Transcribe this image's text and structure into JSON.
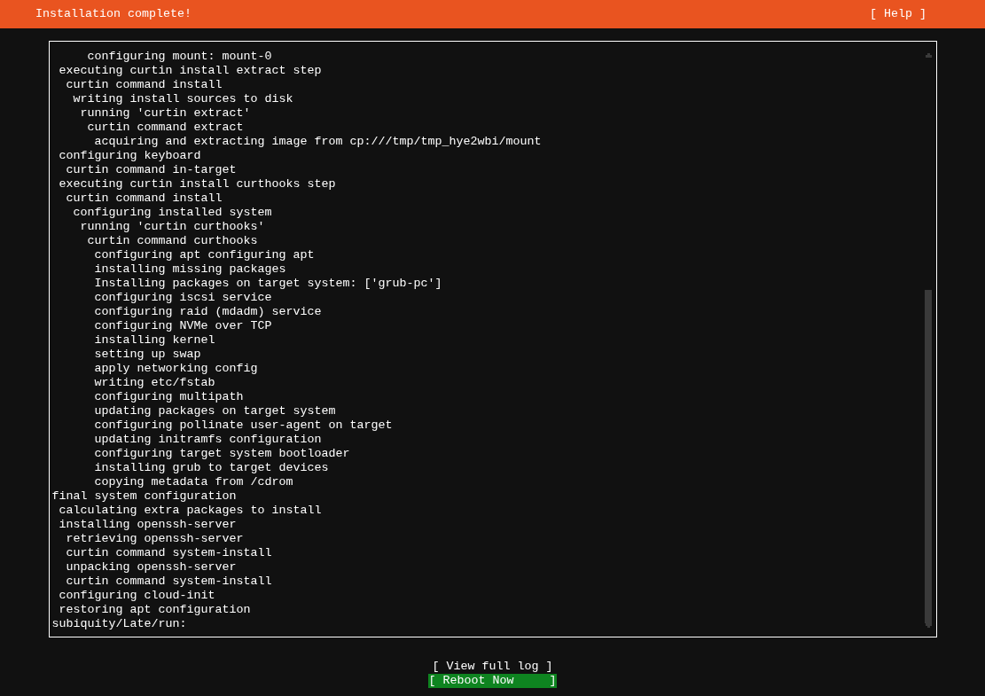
{
  "header": {
    "title": "Installation complete!",
    "help": "[ Help ]"
  },
  "log": [
    {
      "children": [
        {
          "children": [
            {
              "children": [
                {
                  "children": [
                    {
                      "children": [
                        {
                          "text": "configuring mount: mount-0"
                        }
                      ]
                    }
                  ]
                }
              ]
            }
          ]
        },
        {
          "text": "executing curtin install extract step",
          "children": [
            {
              "text": "curtin command install",
              "children": [
                {
                  "text": "writing install sources to disk",
                  "children": [
                    {
                      "text": "running 'curtin extract'",
                      "children": [
                        {
                          "text": "curtin command extract",
                          "children": [
                            {
                              "text": "acquiring and extracting image from cp:///tmp/tmp_hye2wbi/mount"
                            }
                          ]
                        }
                      ]
                    }
                  ]
                }
              ]
            }
          ]
        },
        {
          "text": "configuring keyboard",
          "children": [
            {
              "text": "curtin command in-target"
            }
          ]
        },
        {
          "text": "executing curtin install curthooks step",
          "children": [
            {
              "text": "curtin command install",
              "children": [
                {
                  "text": "configuring installed system",
                  "children": [
                    {
                      "text": "running 'curtin curthooks'",
                      "children": [
                        {
                          "text": "curtin command curthooks",
                          "children": [
                            {
                              "text": "configuring apt configuring apt"
                            },
                            {
                              "text": "installing missing packages"
                            },
                            {
                              "text": "Installing packages on target system: ['grub-pc']"
                            },
                            {
                              "text": "configuring iscsi service"
                            },
                            {
                              "text": "configuring raid (mdadm) service"
                            },
                            {
                              "text": "configuring NVMe over TCP"
                            },
                            {
                              "text": "installing kernel"
                            },
                            {
                              "text": "setting up swap"
                            },
                            {
                              "text": "apply networking config"
                            },
                            {
                              "text": "writing etc/fstab"
                            },
                            {
                              "text": "configuring multipath"
                            },
                            {
                              "text": "updating packages on target system"
                            },
                            {
                              "text": "configuring pollinate user-agent on target"
                            },
                            {
                              "text": "updating initramfs configuration"
                            },
                            {
                              "text": "configuring target system bootloader"
                            },
                            {
                              "text": "installing grub to target devices"
                            },
                            {
                              "text": "copying metadata from /cdrom"
                            }
                          ]
                        }
                      ]
                    }
                  ]
                }
              ]
            }
          ]
        }
      ]
    },
    {
      "text": "final system configuration",
      "children": [
        {
          "text": "calculating extra packages to install"
        },
        {
          "text": "installing openssh-server",
          "children": [
            {
              "text": "retrieving openssh-server"
            },
            {
              "text": "curtin command system-install"
            },
            {
              "text": "unpacking openssh-server"
            },
            {
              "text": "curtin command system-install"
            }
          ]
        },
        {
          "text": "configuring cloud-init"
        },
        {
          "text": "restoring apt configuration"
        }
      ]
    },
    {
      "text": "subiquity/Late/run:"
    }
  ],
  "buttons": [
    {
      "label": "[ View full log ]",
      "selected": false
    },
    {
      "label": "[ Reboot Now     ]",
      "selected": true
    }
  ]
}
